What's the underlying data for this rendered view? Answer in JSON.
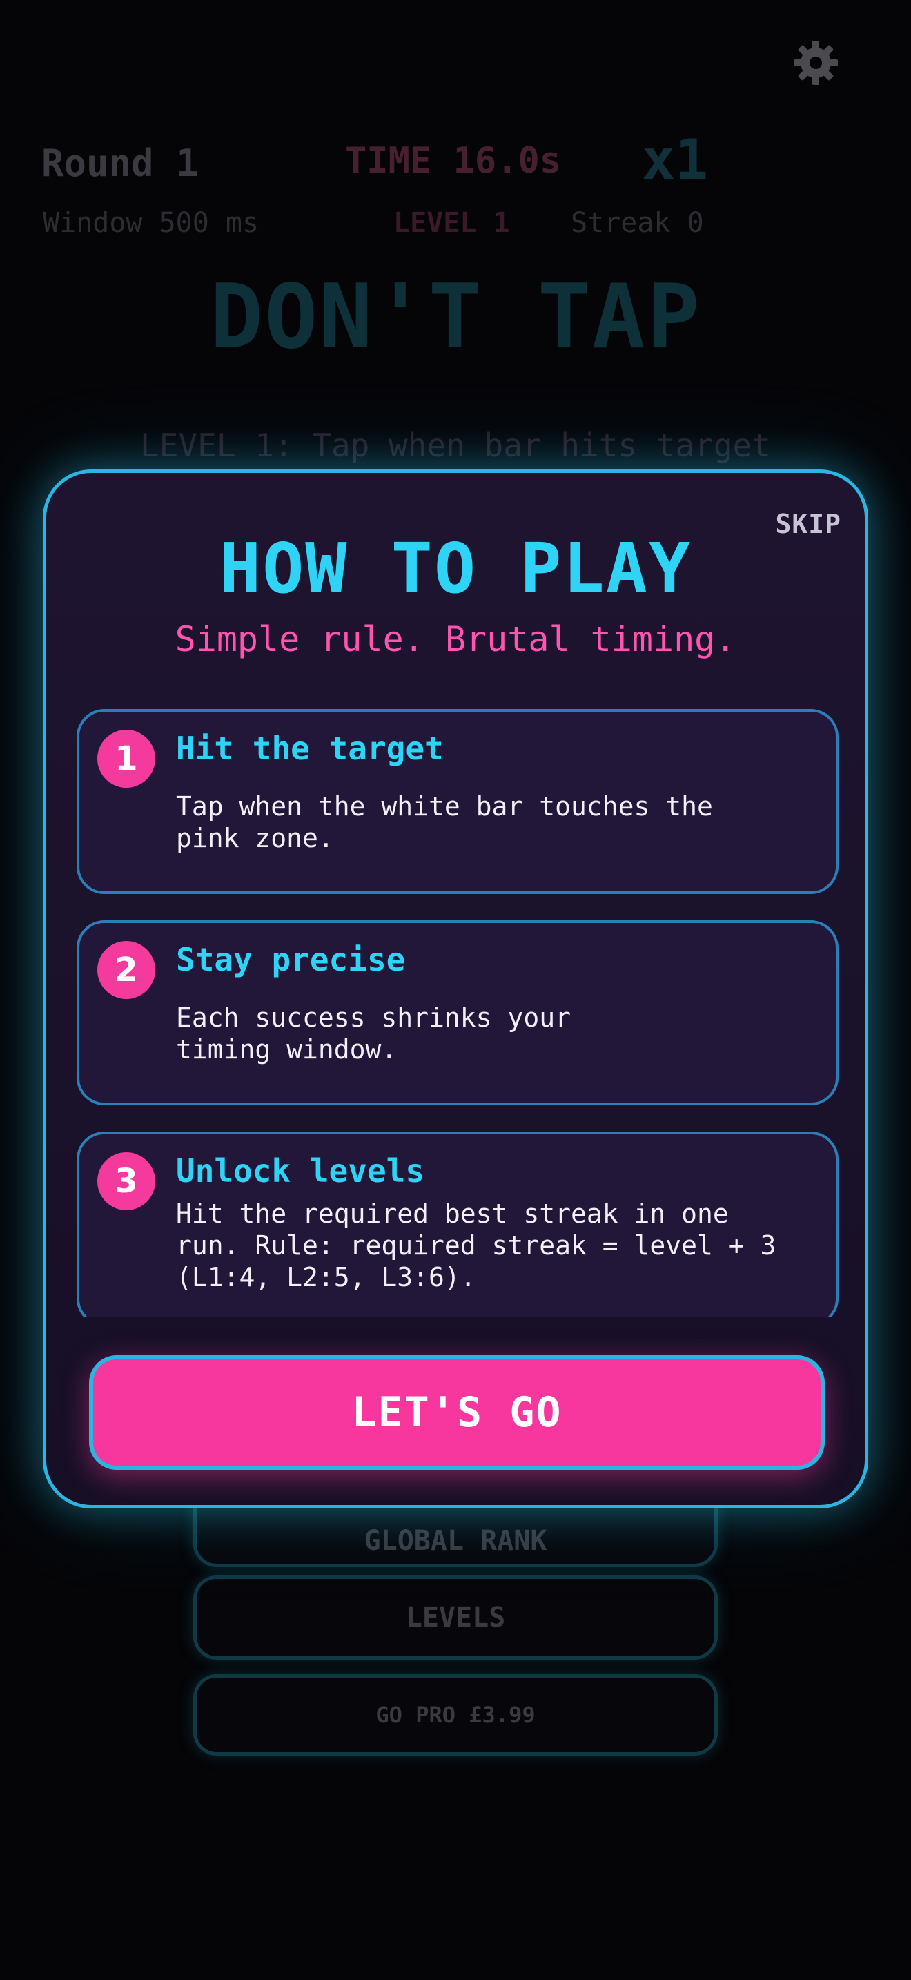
{
  "hud": {
    "settings_icon": "gear-icon",
    "round": "Round 1",
    "time": "TIME 16.0s",
    "multiplier": "x1",
    "window": "Window 500 ms",
    "level": "LEVEL 1",
    "streak": "Streak 0"
  },
  "game": {
    "title": "DON'T TAP",
    "level_hint": "LEVEL 1: Tap when bar hits target"
  },
  "menu": {
    "global_rank": "GLOBAL RANK",
    "levels": "LEVELS",
    "go_pro": "GO PRO £3.99"
  },
  "modal": {
    "skip": "SKIP",
    "title": "HOW TO PLAY",
    "subtitle": "Simple rule. Brutal timing.",
    "steps": [
      {
        "number": "1",
        "title": "Hit the target",
        "description": "Tap when the white bar touches the\npink zone."
      },
      {
        "number": "2",
        "title": "Stay precise",
        "description": "Each success shrinks your\ntiming window."
      },
      {
        "number": "3",
        "title": "Unlock levels",
        "description": "Hit the required best streak in one\nrun. Rule: required streak = level + 3\n(L1:4, L2:5, L3:6)."
      }
    ],
    "cta": "LET'S GO"
  },
  "colors": {
    "accent_cyan": "#2fd3f5",
    "accent_pink": "#f7379d",
    "modal_border": "#2bb5e0",
    "background": "#050508"
  }
}
